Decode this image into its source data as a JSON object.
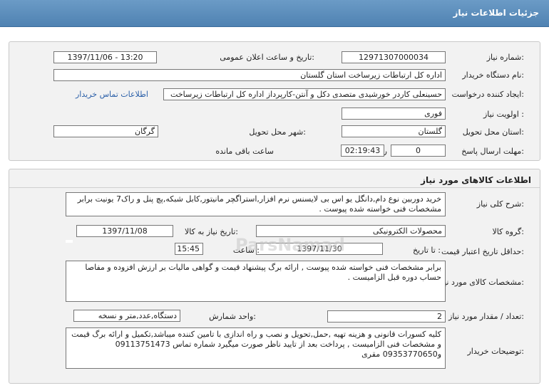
{
  "header": {
    "title": "جزئیات اطلاعات نیاز"
  },
  "info": {
    "need_number_label": "شماره نیاز:",
    "need_number": "12971307000034",
    "announce_label": "تاریخ و ساعت اعلان عمومی:",
    "announce_value": "1397/11/06 - 13:20",
    "buyer_org_label": "نام دستگاه خریدار:",
    "buyer_org": "اداره کل ارتباطات زیرساخت استان گلستان",
    "requester_label": "ایجاد کننده درخواست:",
    "requester": "حسینعلی کاردر خورشیدی متصدی دکل و آنتن-کارپرداز اداره کل ارتباطات زیرساخت",
    "contact_link": "اطلاعات تماس خریدار",
    "priority_label": "اولویت نیاز :",
    "priority": "فوری",
    "province_label": "استان محل تحویل:",
    "province": "گلستان",
    "city_label": "شهر محل تحویل:",
    "city": "گرگان",
    "deadline_label": "مهلت ارسال پاسخ:",
    "days_value": "0",
    "days_unit": "روز و",
    "time_value": "02:19:43",
    "time_suffix": "ساعت باقی مانده"
  },
  "goods": {
    "section_title": "اطلاعات کالاهای مورد نیاز",
    "summary_label": "شرح کلی نیاز:",
    "summary": "خرید دوربین نوع دام,دانگل یو اس بی لایسنس نرم افزار,استراگچر مانیتور,کابل شبکه,پچ پنل و راک7 یونیت برابر مشخصات فنی خواسته شده پیوست .",
    "group_label": "گروه کالا:",
    "group": "محصولات الکترونیکی",
    "need_date_label": "تاریخ نیاز به کالا:",
    "need_date": "1397/11/08",
    "validity_label": "حداقل تاریخ اعتبار قیمت:",
    "until_date_label": "تا تاریخ :",
    "until_date": "1397/11/30",
    "hour_label": "ساعت :",
    "hour": "15:45",
    "spec_label": "مشخصات کالای مورد نیاز:",
    "spec": "برابر مشخصات فنی خواسته شده پیوست , ارائه برگ پیشنهاد قیمت و گواهی مالیات بر ارزش افزوده و مفاصا حساب دوره قبل الزامیست .",
    "qty_label": "تعداد / مقدار مورد نیاز:",
    "qty": "2",
    "unit_label": "واحد شمارش:",
    "unit": "دستگاه,عدد,متر و نسخه",
    "notes_label": "توضیحات خریدار:",
    "notes": "کلیه کسورات قانونی و هزینه تهیه ,حمل,تحویل و نصب و راه اندازی با تامین کننده میباشد,تکمیل و ارائه برگ قیمت و مشخصات فنی الزامیست , پرداخت بعد از تایید ناظر صورت میگیرد شماره تماس 09113751473 و09353770650 مقری"
  }
}
